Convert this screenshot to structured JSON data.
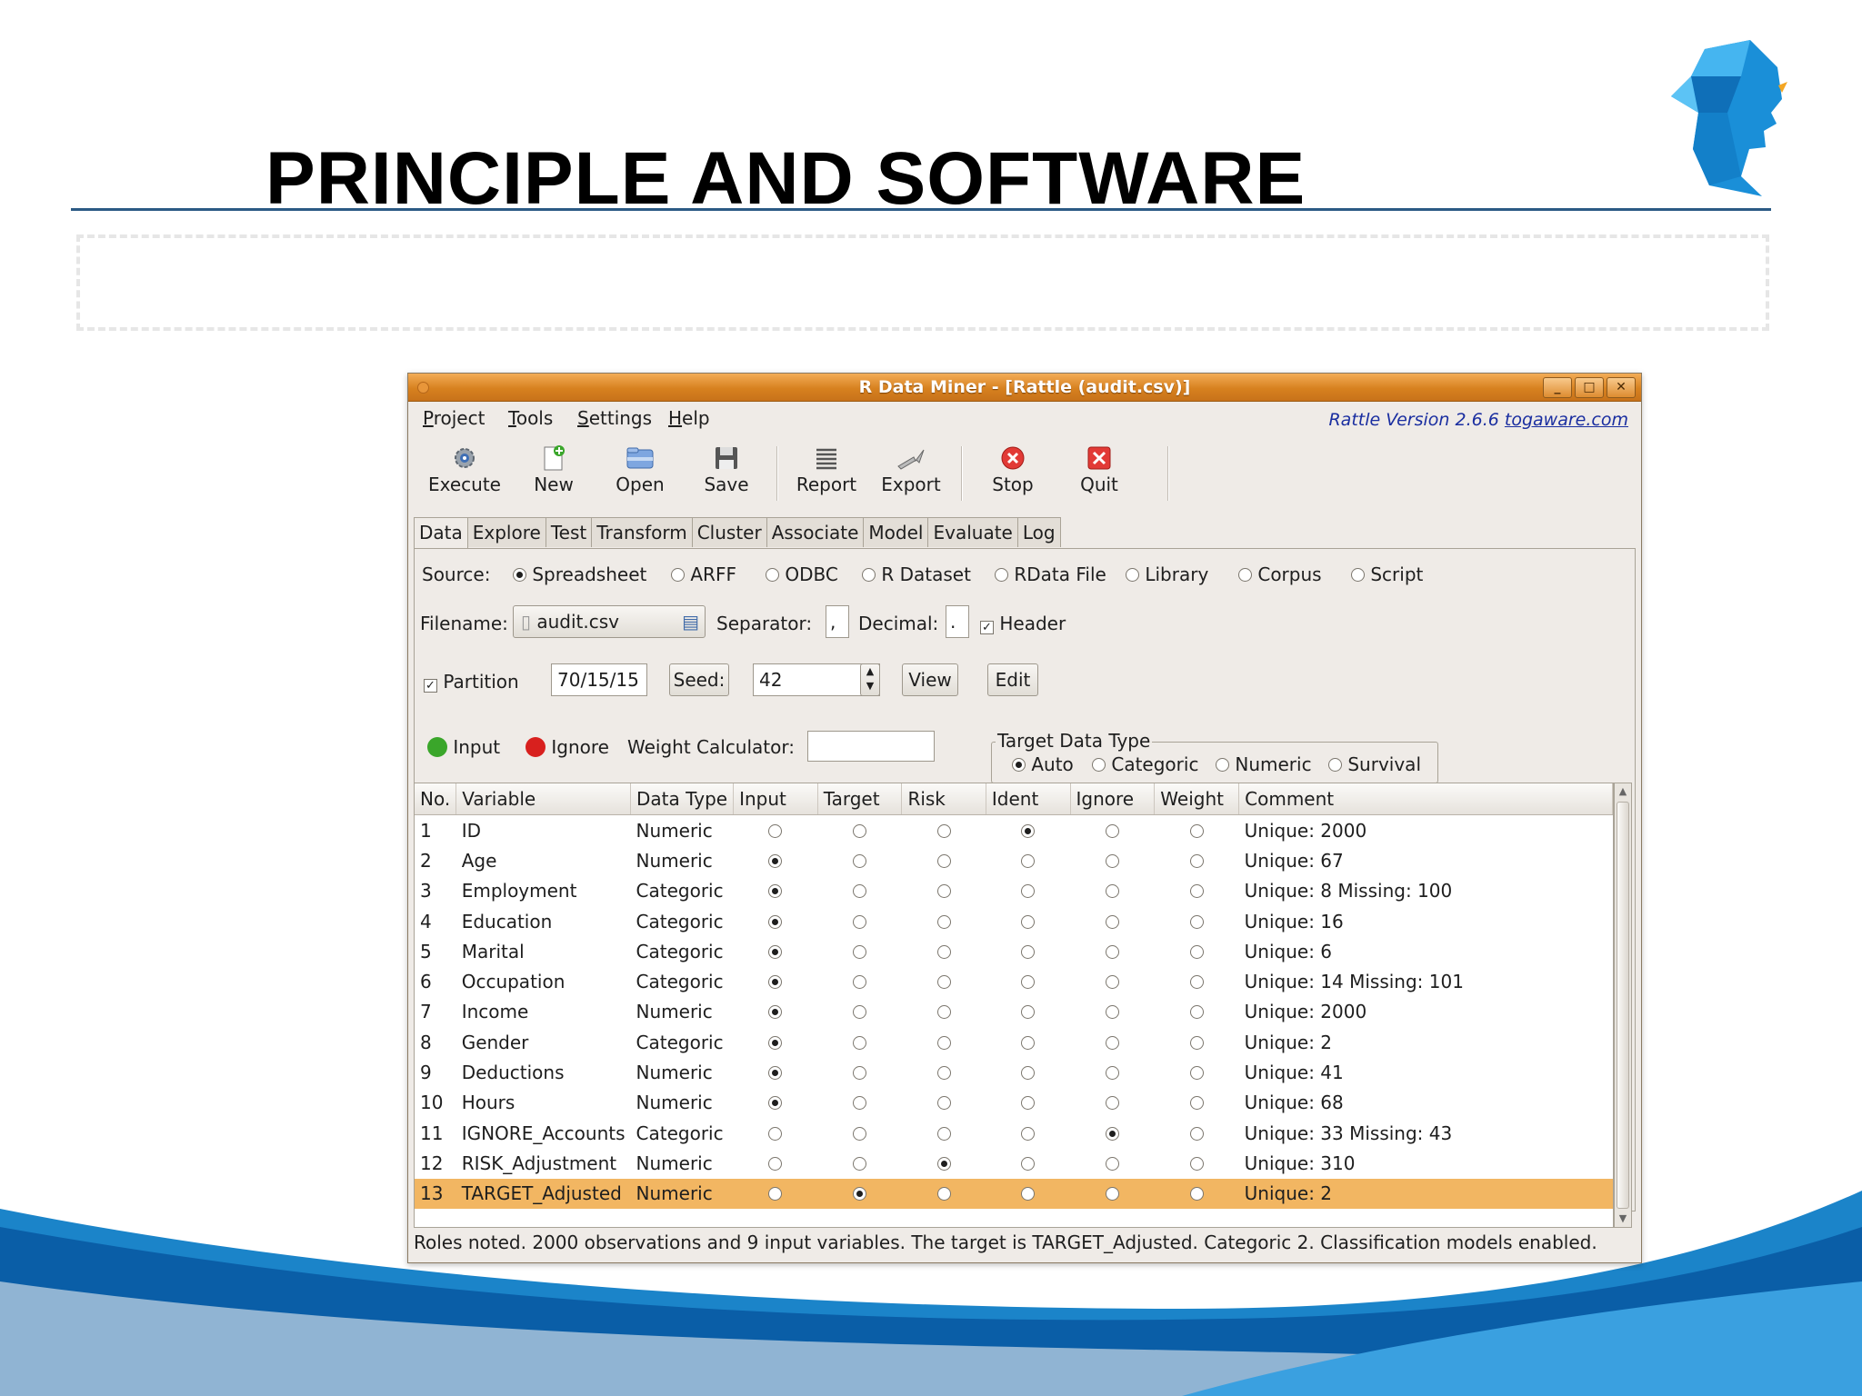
{
  "slide": {
    "title": "PRINCIPLE AND SOFTWARE"
  },
  "window": {
    "title": "R Data Miner - [Rattle (audit.csv)]",
    "controls": [
      "_",
      "□",
      "✕"
    ]
  },
  "menu": {
    "items": [
      {
        "first": "P",
        "rest": "roject"
      },
      {
        "first": "T",
        "rest": "ools"
      },
      {
        "first": "S",
        "rest": "ettings"
      },
      {
        "first": "H",
        "rest": "elp"
      }
    ],
    "version_text": "Rattle Version 2.6.6",
    "version_link": "togaware.com"
  },
  "toolbar": {
    "items": [
      {
        "label": "Execute",
        "icon": "gear-icon"
      },
      {
        "label": "New",
        "icon": "new-document-icon"
      },
      {
        "label": "Open",
        "icon": "open-icon"
      },
      {
        "label": "Save",
        "icon": "floppy-disk-icon"
      },
      {
        "label": "Report",
        "icon": "report-icon"
      },
      {
        "label": "Export",
        "icon": "export-icon"
      },
      {
        "label": "Stop",
        "icon": "stop-icon"
      },
      {
        "label": "Quit",
        "icon": "quit-icon"
      }
    ]
  },
  "tabs": [
    "Data",
    "Explore",
    "Test",
    "Transform",
    "Cluster",
    "Associate",
    "Model",
    "Evaluate",
    "Log"
  ],
  "active_tab": "Data",
  "source": {
    "label": "Source:",
    "options": [
      "Spreadsheet",
      "ARFF",
      "ODBC",
      "R Dataset",
      "RData File",
      "Library",
      "Corpus",
      "Script"
    ],
    "selected": "Spreadsheet"
  },
  "file": {
    "filename_label": "Filename:",
    "filename_value": "audit.csv",
    "separator_label": "Separator:",
    "separator_value": ",",
    "decimal_label": "Decimal:",
    "decimal_value": ".",
    "header_label": "Header",
    "header_checked": true
  },
  "partition": {
    "label": "Partition",
    "checked": true,
    "value": "70/15/15",
    "seed_button": "Seed:",
    "seed_value": "42",
    "view_button": "View",
    "edit_button": "Edit"
  },
  "roles": {
    "input_label": "Input",
    "input_color": "#3aa62a",
    "ignore_label": "Ignore",
    "ignore_color": "#d8201e",
    "weight_label": "Weight Calculator:",
    "weight_value": ""
  },
  "target_type": {
    "label": "Target Data Type",
    "options": [
      "Auto",
      "Categoric",
      "Numeric",
      "Survival"
    ],
    "selected": "Auto"
  },
  "variables": {
    "columns": [
      "No.",
      "Variable",
      "Data Type",
      "Input",
      "Target",
      "Risk",
      "Ident",
      "Ignore",
      "Weight",
      "Comment"
    ],
    "role_columns": [
      "Input",
      "Target",
      "Risk",
      "Ident",
      "Ignore",
      "Weight"
    ],
    "rows": [
      {
        "no": "1",
        "name": "ID",
        "type": "Numeric",
        "role": "Ident",
        "comment": "Unique: 2000"
      },
      {
        "no": "2",
        "name": "Age",
        "type": "Numeric",
        "role": "Input",
        "comment": "Unique: 67"
      },
      {
        "no": "3",
        "name": "Employment",
        "type": "Categoric",
        "role": "Input",
        "comment": "Unique: 8 Missing: 100"
      },
      {
        "no": "4",
        "name": "Education",
        "type": "Categoric",
        "role": "Input",
        "comment": "Unique: 16"
      },
      {
        "no": "5",
        "name": "Marital",
        "type": "Categoric",
        "role": "Input",
        "comment": "Unique: 6"
      },
      {
        "no": "6",
        "name": "Occupation",
        "type": "Categoric",
        "role": "Input",
        "comment": "Unique: 14 Missing: 101"
      },
      {
        "no": "7",
        "name": "Income",
        "type": "Numeric",
        "role": "Input",
        "comment": "Unique: 2000"
      },
      {
        "no": "8",
        "name": "Gender",
        "type": "Categoric",
        "role": "Input",
        "comment": "Unique: 2"
      },
      {
        "no": "9",
        "name": "Deductions",
        "type": "Numeric",
        "role": "Input",
        "comment": "Unique: 41"
      },
      {
        "no": "10",
        "name": "Hours",
        "type": "Numeric",
        "role": "Input",
        "comment": "Unique: 68"
      },
      {
        "no": "11",
        "name": "IGNORE_Accounts",
        "type": "Categoric",
        "role": "Ignore",
        "comment": "Unique: 33 Missing: 43"
      },
      {
        "no": "12",
        "name": "RISK_Adjustment",
        "type": "Numeric",
        "role": "Risk",
        "comment": "Unique: 310"
      },
      {
        "no": "13",
        "name": "TARGET_Adjusted",
        "type": "Numeric",
        "role": "Target",
        "comment": "Unique: 2",
        "selected": true
      }
    ]
  },
  "status": "Roles noted. 2000 observations and 9 input variables. The target is TARGET_Adjusted. Categoric 2. Classification models enabled."
}
